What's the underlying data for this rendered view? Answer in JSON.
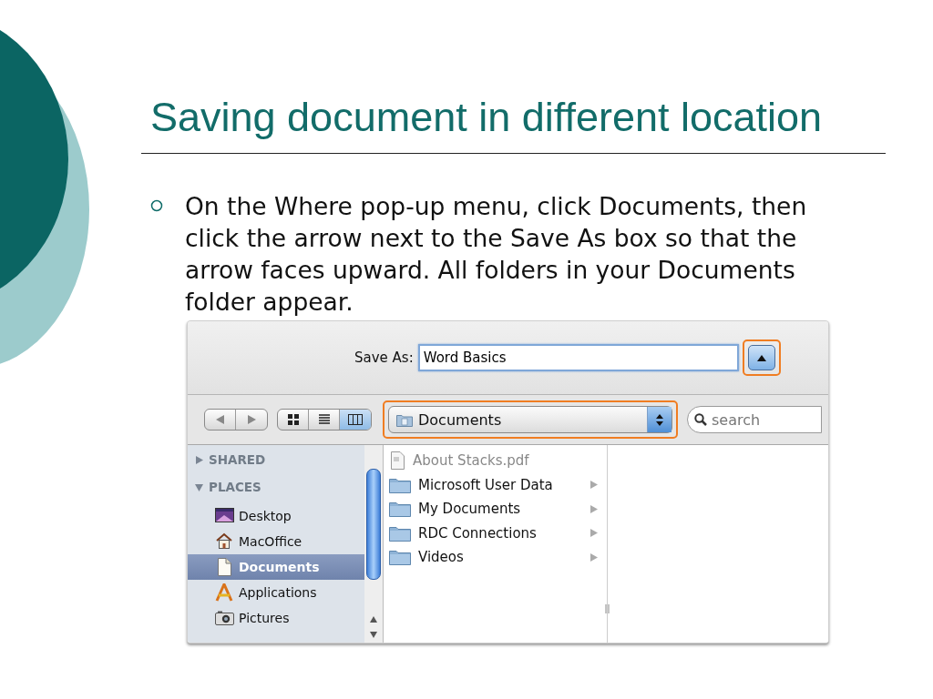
{
  "slide": {
    "title": "Saving document in different location",
    "bullets": [
      "On the Where pop-up menu, click Documents, then click the arrow next to the Save As box so that the arrow faces upward. All folders in your Documents folder appear."
    ]
  },
  "dialog": {
    "save_as": {
      "label": "Save As:",
      "value": "Word Basics",
      "toggle_expanded": true,
      "toggle_highlighted": true
    },
    "nav_buttons": [
      {
        "kind": "back",
        "disabled": true
      },
      {
        "kind": "forward",
        "disabled": true
      }
    ],
    "view_buttons": [
      {
        "kind": "icons",
        "selected": false
      },
      {
        "kind": "list",
        "selected": false
      },
      {
        "kind": "columns",
        "selected": true
      }
    ],
    "where": {
      "value": "Documents",
      "highlighted": true
    },
    "search": {
      "placeholder": "search"
    },
    "sidebar": [
      {
        "label": "SHARED",
        "expanded": false
      },
      {
        "label": "PLACES",
        "expanded": true,
        "children": [
          {
            "label": "Desktop",
            "kind": "desktop",
            "selected": false
          },
          {
            "label": "MacOffice",
            "kind": "home",
            "selected": false
          },
          {
            "label": "Documents",
            "kind": "documents",
            "selected": true
          },
          {
            "label": "Applications",
            "kind": "applications",
            "selected": false
          },
          {
            "label": "Pictures",
            "kind": "pictures",
            "selected": false
          }
        ]
      }
    ],
    "files": [
      {
        "name": "About Stacks.pdf",
        "kind": "pdf",
        "disabled": true
      },
      {
        "name": "Microsoft User Data",
        "kind": "folder",
        "disabled": false
      },
      {
        "name": "My Documents",
        "kind": "folder",
        "disabled": false
      },
      {
        "name": "RDC Connections",
        "kind": "folder",
        "disabled": false
      },
      {
        "name": "Videos",
        "kind": "folder",
        "disabled": false
      }
    ]
  }
}
